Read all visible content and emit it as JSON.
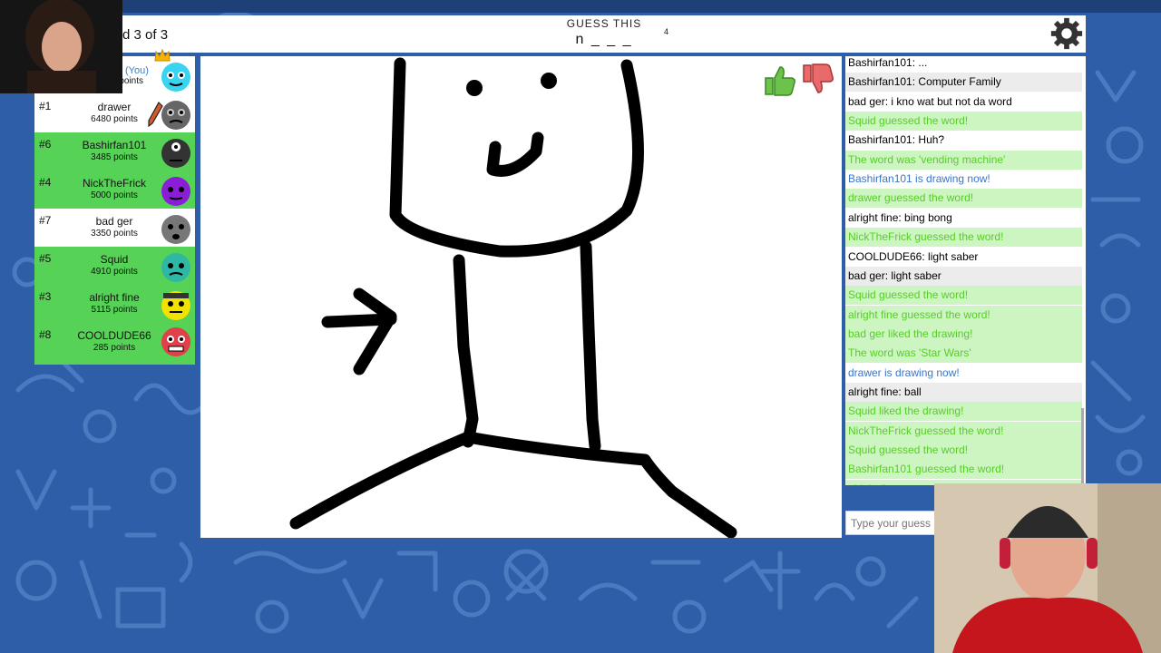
{
  "header": {
    "round_text": "d 3 of 3",
    "guess_label": "GUESS THIS",
    "hint": "n _ _ _",
    "letter_count": "4"
  },
  "players": [
    {
      "rank": "",
      "name": "(You)",
      "points": "points",
      "color": "#fff",
      "avatar": "cyan-avatar",
      "you": true
    },
    {
      "rank": "#1",
      "name": "drawer",
      "points": "6480 points",
      "color": "#fff",
      "avatar": "gray-avatar-drawing"
    },
    {
      "rank": "#6",
      "name": "Bashirfan101",
      "points": "3485 points",
      "color": "#56d256",
      "avatar": "black-avatar"
    },
    {
      "rank": "#4",
      "name": "NickTheFrick",
      "points": "5000 points",
      "color": "#56d256",
      "avatar": "purple-avatar"
    },
    {
      "rank": "#7",
      "name": "bad ger",
      "points": "3350 points",
      "color": "#fff",
      "avatar": "gray-avatar"
    },
    {
      "rank": "#5",
      "name": "Squid",
      "points": "4910 points",
      "color": "#56d256",
      "avatar": "teal-avatar"
    },
    {
      "rank": "#3",
      "name": "alright fine",
      "points": "5115 points",
      "color": "#56d256",
      "avatar": "yellow-avatar"
    },
    {
      "rank": "#8",
      "name": "COOLDUDE66",
      "points": "285 points",
      "color": "#56d256",
      "avatar": "red-avatar"
    }
  ],
  "chat": [
    {
      "user": "",
      "text": "Bashirfan101: ...",
      "style": "partial"
    },
    {
      "user": "Bashirfan101:",
      "text": "Computer Family",
      "style": "alt"
    },
    {
      "user": "bad ger:",
      "text": "i kno wat but not da word",
      "style": "plain"
    },
    {
      "user": "",
      "text": "Squid guessed the word!",
      "style": "green"
    },
    {
      "user": "Bashirfan101:",
      "text": "Huh?",
      "style": "plain"
    },
    {
      "user": "",
      "text": "The word was 'vending machine'",
      "style": "green"
    },
    {
      "user": "",
      "text": "Bashirfan101 is drawing now!",
      "style": "blue"
    },
    {
      "user": "",
      "text": "drawer guessed the word!",
      "style": "green"
    },
    {
      "user": "alright fine:",
      "text": "bing bong",
      "style": "plain"
    },
    {
      "user": "",
      "text": "NickTheFrick guessed the word!",
      "style": "green"
    },
    {
      "user": "COOLDUDE66:",
      "text": "light saber",
      "style": "plain"
    },
    {
      "user": "bad ger:",
      "text": "light saber",
      "style": "alt"
    },
    {
      "user": "",
      "text": "Squid guessed the word!",
      "style": "green"
    },
    {
      "user": "",
      "text": "alright fine guessed the word!",
      "style": "green"
    },
    {
      "user": "",
      "text": "bad ger liked the drawing!",
      "style": "green"
    },
    {
      "user": "",
      "text": "The word was 'Star Wars'",
      "style": "green"
    },
    {
      "user": "",
      "text": "drawer is drawing now!",
      "style": "blue"
    },
    {
      "user": "alright fine:",
      "text": "ball",
      "style": "alt"
    },
    {
      "user": "",
      "text": "Squid liked the drawing!",
      "style": "green"
    },
    {
      "user": "",
      "text": "NickTheFrick guessed the word!",
      "style": "green"
    },
    {
      "user": "",
      "text": "Squid guessed the word!",
      "style": "green"
    },
    {
      "user": "",
      "text": "Bashirfan101 guessed the word!",
      "style": "green"
    },
    {
      "user": "",
      "text": "alright fine guessed the word!",
      "style": "green"
    }
  ],
  "chat_input": {
    "placeholder": "Type your guess"
  },
  "colors": {
    "background": "#2e5ea8",
    "green": "#56d256",
    "chat_green": "#56ce27",
    "chat_blue": "#3975ce"
  },
  "icons": {
    "settings": "gear-icon",
    "like": "thumbs-up-icon",
    "dislike": "thumbs-down-icon",
    "owner": "crown-icon",
    "drawing": "pencil-icon"
  }
}
